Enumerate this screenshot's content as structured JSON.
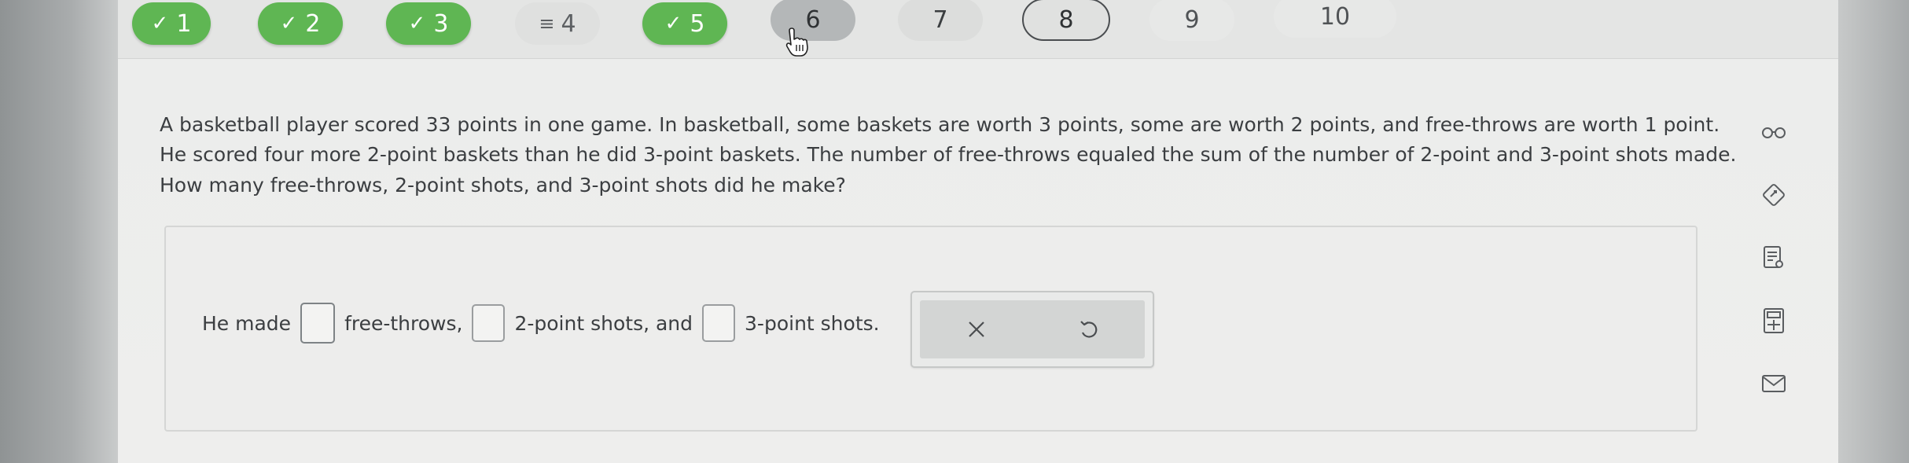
{
  "nav": {
    "questions": [
      {
        "label": "1",
        "status": "done",
        "icon": "check-icon"
      },
      {
        "label": "2",
        "status": "done",
        "icon": "check-icon"
      },
      {
        "label": "3",
        "status": "done",
        "icon": "check-icon"
      },
      {
        "label": "4",
        "status": "partial",
        "icon": "lines-icon"
      },
      {
        "label": "5",
        "status": "done",
        "icon": "check-icon"
      },
      {
        "label": "6",
        "status": "current"
      },
      {
        "label": "7",
        "status": "unanswered"
      },
      {
        "label": "8",
        "status": "unanswered"
      },
      {
        "label": "9",
        "status": "unanswered"
      },
      {
        "label": "10",
        "status": "unanswered"
      }
    ]
  },
  "question": {
    "line1": "A basketball player scored 33 points in one game. In basketball, some baskets are worth 3 points, some are worth 2 points, and free-throws are worth 1 point.",
    "line2": "He scored four more 2-point baskets than he did 3-point baskets. The number of free-throws equaled the sum of the number of 2-point and 3-point shots made.",
    "line3": "How many free-throws, 2-point shots, and 3-point shots did he make?"
  },
  "answer": {
    "prefix": "He made",
    "part1": "free-throws,",
    "part2": "2-point shots, and",
    "part3": "3-point shots.",
    "blank1": "",
    "blank2": "",
    "blank3": ""
  },
  "tools": {
    "clear_icon": "close-icon",
    "undo_icon": "undo-icon"
  },
  "side_tools": [
    "glasses-icon",
    "highlighter-icon",
    "notepad-icon",
    "calculator-icon",
    "mail-icon"
  ],
  "colors": {
    "done_pill": "#5fb653",
    "current_pill": "#b4b7b8"
  }
}
